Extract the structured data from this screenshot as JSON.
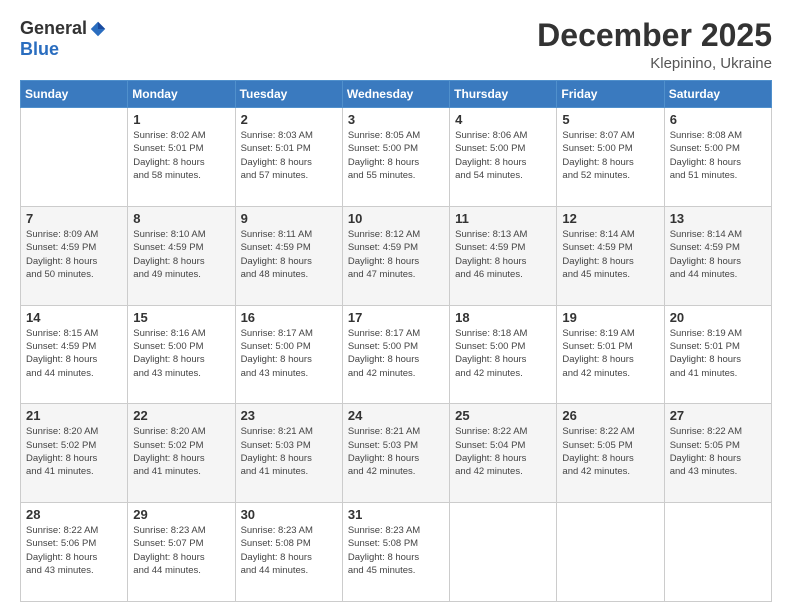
{
  "logo": {
    "general": "General",
    "blue": "Blue"
  },
  "title": "December 2025",
  "location": "Klepinino, Ukraine",
  "days_header": [
    "Sunday",
    "Monday",
    "Tuesday",
    "Wednesday",
    "Thursday",
    "Friday",
    "Saturday"
  ],
  "weeks": [
    [
      {
        "day": "",
        "info": ""
      },
      {
        "day": "1",
        "info": "Sunrise: 8:02 AM\nSunset: 5:01 PM\nDaylight: 8 hours\nand 58 minutes."
      },
      {
        "day": "2",
        "info": "Sunrise: 8:03 AM\nSunset: 5:01 PM\nDaylight: 8 hours\nand 57 minutes."
      },
      {
        "day": "3",
        "info": "Sunrise: 8:05 AM\nSunset: 5:00 PM\nDaylight: 8 hours\nand 55 minutes."
      },
      {
        "day": "4",
        "info": "Sunrise: 8:06 AM\nSunset: 5:00 PM\nDaylight: 8 hours\nand 54 minutes."
      },
      {
        "day": "5",
        "info": "Sunrise: 8:07 AM\nSunset: 5:00 PM\nDaylight: 8 hours\nand 52 minutes."
      },
      {
        "day": "6",
        "info": "Sunrise: 8:08 AM\nSunset: 5:00 PM\nDaylight: 8 hours\nand 51 minutes."
      }
    ],
    [
      {
        "day": "7",
        "info": "Sunrise: 8:09 AM\nSunset: 4:59 PM\nDaylight: 8 hours\nand 50 minutes."
      },
      {
        "day": "8",
        "info": "Sunrise: 8:10 AM\nSunset: 4:59 PM\nDaylight: 8 hours\nand 49 minutes."
      },
      {
        "day": "9",
        "info": "Sunrise: 8:11 AM\nSunset: 4:59 PM\nDaylight: 8 hours\nand 48 minutes."
      },
      {
        "day": "10",
        "info": "Sunrise: 8:12 AM\nSunset: 4:59 PM\nDaylight: 8 hours\nand 47 minutes."
      },
      {
        "day": "11",
        "info": "Sunrise: 8:13 AM\nSunset: 4:59 PM\nDaylight: 8 hours\nand 46 minutes."
      },
      {
        "day": "12",
        "info": "Sunrise: 8:14 AM\nSunset: 4:59 PM\nDaylight: 8 hours\nand 45 minutes."
      },
      {
        "day": "13",
        "info": "Sunrise: 8:14 AM\nSunset: 4:59 PM\nDaylight: 8 hours\nand 44 minutes."
      }
    ],
    [
      {
        "day": "14",
        "info": "Sunrise: 8:15 AM\nSunset: 4:59 PM\nDaylight: 8 hours\nand 44 minutes."
      },
      {
        "day": "15",
        "info": "Sunrise: 8:16 AM\nSunset: 5:00 PM\nDaylight: 8 hours\nand 43 minutes."
      },
      {
        "day": "16",
        "info": "Sunrise: 8:17 AM\nSunset: 5:00 PM\nDaylight: 8 hours\nand 43 minutes."
      },
      {
        "day": "17",
        "info": "Sunrise: 8:17 AM\nSunset: 5:00 PM\nDaylight: 8 hours\nand 42 minutes."
      },
      {
        "day": "18",
        "info": "Sunrise: 8:18 AM\nSunset: 5:00 PM\nDaylight: 8 hours\nand 42 minutes."
      },
      {
        "day": "19",
        "info": "Sunrise: 8:19 AM\nSunset: 5:01 PM\nDaylight: 8 hours\nand 42 minutes."
      },
      {
        "day": "20",
        "info": "Sunrise: 8:19 AM\nSunset: 5:01 PM\nDaylight: 8 hours\nand 41 minutes."
      }
    ],
    [
      {
        "day": "21",
        "info": "Sunrise: 8:20 AM\nSunset: 5:02 PM\nDaylight: 8 hours\nand 41 minutes."
      },
      {
        "day": "22",
        "info": "Sunrise: 8:20 AM\nSunset: 5:02 PM\nDaylight: 8 hours\nand 41 minutes."
      },
      {
        "day": "23",
        "info": "Sunrise: 8:21 AM\nSunset: 5:03 PM\nDaylight: 8 hours\nand 41 minutes."
      },
      {
        "day": "24",
        "info": "Sunrise: 8:21 AM\nSunset: 5:03 PM\nDaylight: 8 hours\nand 42 minutes."
      },
      {
        "day": "25",
        "info": "Sunrise: 8:22 AM\nSunset: 5:04 PM\nDaylight: 8 hours\nand 42 minutes."
      },
      {
        "day": "26",
        "info": "Sunrise: 8:22 AM\nSunset: 5:05 PM\nDaylight: 8 hours\nand 42 minutes."
      },
      {
        "day": "27",
        "info": "Sunrise: 8:22 AM\nSunset: 5:05 PM\nDaylight: 8 hours\nand 43 minutes."
      }
    ],
    [
      {
        "day": "28",
        "info": "Sunrise: 8:22 AM\nSunset: 5:06 PM\nDaylight: 8 hours\nand 43 minutes."
      },
      {
        "day": "29",
        "info": "Sunrise: 8:23 AM\nSunset: 5:07 PM\nDaylight: 8 hours\nand 44 minutes."
      },
      {
        "day": "30",
        "info": "Sunrise: 8:23 AM\nSunset: 5:08 PM\nDaylight: 8 hours\nand 44 minutes."
      },
      {
        "day": "31",
        "info": "Sunrise: 8:23 AM\nSunset: 5:08 PM\nDaylight: 8 hours\nand 45 minutes."
      },
      {
        "day": "",
        "info": ""
      },
      {
        "day": "",
        "info": ""
      },
      {
        "day": "",
        "info": ""
      }
    ]
  ]
}
